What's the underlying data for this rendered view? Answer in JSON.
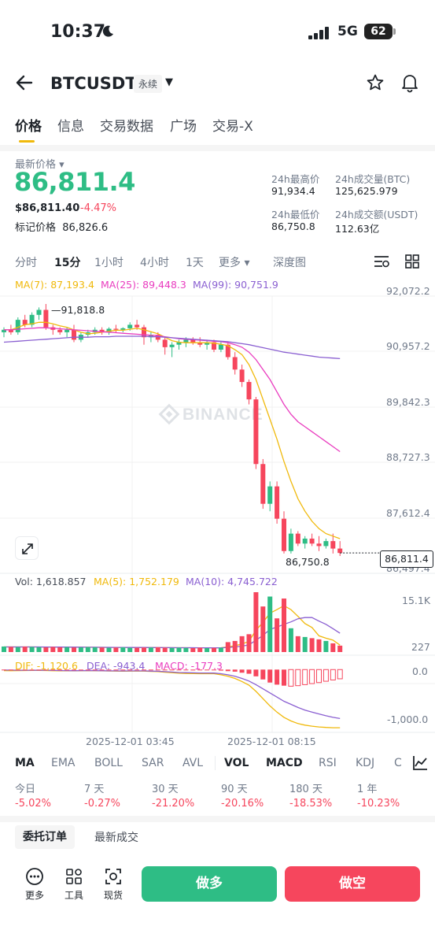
{
  "status": {
    "time": "10:37",
    "network": "5G",
    "battery": "62"
  },
  "header": {
    "symbol": "BTCUSDT",
    "contract_type": "永续"
  },
  "tabs": [
    {
      "label": "价格",
      "active": true
    },
    {
      "label": "信息"
    },
    {
      "label": "交易数据"
    },
    {
      "label": "广场"
    },
    {
      "label": "交易-X"
    }
  ],
  "price": {
    "label": "最新价格",
    "last": "86,811.4",
    "usd": "$86,811.40",
    "change": "-4.47%",
    "mark_label": "标记价格",
    "mark": "86,826.6"
  },
  "stats": {
    "high_label": "24h最高价",
    "high": "91,934.4",
    "vol_btc_label": "24h成交量(BTC)",
    "vol_btc": "125,625.979",
    "low_label": "24h最低价",
    "low": "86,750.8",
    "vol_usdt_label": "24h成交额(USDT)",
    "vol_usdt": "112.63亿"
  },
  "timeframes": [
    {
      "label": "分时"
    },
    {
      "label": "15分",
      "active": true
    },
    {
      "label": "1小时"
    },
    {
      "label": "4小时"
    },
    {
      "label": "1天"
    },
    {
      "label": "更多"
    },
    {
      "label": "深度图"
    }
  ],
  "legend": {
    "ma7": "MA(7): 87,193.4",
    "ma25": "MA(25): 89,448.3",
    "ma99": "MA(99): 90,751.9",
    "vol": "Vol: 1,618.857",
    "ma5": "MA(5): 1,752.179",
    "ma10": "MA(10): 4,745.722",
    "dif": "DIF: -1,120.6",
    "dea": "DEA: -943.4",
    "macd": "MACD: -177.3"
  },
  "colors": {
    "up": "#2ebd85",
    "down": "#f6465d",
    "ma7": "#f0b90b",
    "ma25": "#e93cbf",
    "ma99": "#8a5fd1",
    "accent": "#f0b90b"
  },
  "chart_labels": {
    "high_marker": "91,818.8",
    "low_marker": "86,750.8",
    "last_price": "86,811.4",
    "watermark": "BINANCE",
    "dates": [
      "2025-12-01 03:45",
      "2025-12-01 08:15"
    ]
  },
  "chart_data": [
    {
      "type": "candlestick",
      "title": "",
      "y_ticks": [
        "92,072.2",
        "90,957.2",
        "89,842.3",
        "88,727.3",
        "87,612.4",
        "86,497.4"
      ],
      "ylim": [
        86497.4,
        92072.2
      ],
      "candles": [
        [
          91250,
          91350,
          91150,
          91300
        ],
        [
          91300,
          91400,
          91200,
          91250
        ],
        [
          91250,
          91550,
          91200,
          91500
        ],
        [
          91500,
          91600,
          91350,
          91400
        ],
        [
          91400,
          91650,
          91350,
          91600
        ],
        [
          91600,
          91750,
          91500,
          91700
        ],
        [
          91700,
          91818.8,
          91300,
          91350
        ],
        [
          91350,
          91400,
          91200,
          91300
        ],
        [
          91300,
          91350,
          91200,
          91250
        ],
        [
          91250,
          91350,
          91150,
          91300
        ],
        [
          91300,
          91400,
          91050,
          91100
        ],
        [
          91100,
          91250,
          91050,
          91200
        ],
        [
          91200,
          91300,
          91150,
          91250
        ],
        [
          91250,
          91350,
          91200,
          91300
        ],
        [
          91300,
          91350,
          91200,
          91250
        ],
        [
          91250,
          91350,
          91200,
          91320
        ],
        [
          91320,
          91400,
          91250,
          91300
        ],
        [
          91300,
          91350,
          91250,
          91330
        ],
        [
          91330,
          91450,
          91280,
          91400
        ],
        [
          91400,
          91500,
          91300,
          91350
        ],
        [
          91350,
          91400,
          91000,
          91150
        ],
        [
          91150,
          91250,
          91050,
          91200
        ],
        [
          91200,
          91250,
          91050,
          91100
        ],
        [
          91100,
          91150,
          90800,
          90950
        ],
        [
          90950,
          91050,
          90750,
          91000
        ],
        [
          91000,
          91100,
          90900,
          91050
        ],
        [
          91050,
          91150,
          90950,
          91100
        ],
        [
          91100,
          91150,
          91000,
          91050
        ],
        [
          91050,
          91150,
          90950,
          91000
        ],
        [
          91000,
          91100,
          90900,
          91050
        ],
        [
          91050,
          91100,
          90850,
          90900
        ],
        [
          90900,
          91050,
          90850,
          91000
        ],
        [
          91000,
          91050,
          90700,
          90750
        ],
        [
          90750,
          90850,
          90400,
          90500
        ],
        [
          90500,
          90600,
          90150,
          90250
        ],
        [
          90250,
          90300,
          89800,
          89900
        ],
        [
          89900,
          89950,
          88500,
          88600
        ],
        [
          88600,
          88700,
          87700,
          87800
        ],
        [
          87800,
          88250,
          87650,
          88150
        ],
        [
          88150,
          88250,
          87400,
          87500
        ],
        [
          87500,
          87650,
          86800,
          86850
        ],
        [
          86850,
          87300,
          86800,
          87200
        ],
        [
          87200,
          87250,
          86950,
          87000
        ],
        [
          87000,
          87150,
          86900,
          87100
        ],
        [
          87100,
          87200,
          86950,
          87000
        ],
        [
          87000,
          87150,
          86850,
          86950
        ],
        [
          86950,
          87100,
          86900,
          87050
        ],
        [
          87050,
          87200,
          86800,
          86900
        ],
        [
          86900,
          87050,
          86750.8,
          86811.4
        ]
      ],
      "ma7": [
        91300,
        91300,
        91350,
        91400,
        91420,
        91450,
        91450,
        91420,
        91380,
        91350,
        91300,
        91250,
        91220,
        91230,
        91250,
        91270,
        91290,
        91290,
        91310,
        91330,
        91300,
        91260,
        91220,
        91150,
        91080,
        91050,
        91040,
        91040,
        91040,
        91040,
        91030,
        91010,
        90980,
        90900,
        90800,
        90600,
        90300,
        89900,
        89500,
        89100,
        88650,
        88250,
        87900,
        87650,
        87450,
        87300,
        87200,
        87150,
        87100
      ],
      "ma25": [
        91300,
        91300,
        91310,
        91320,
        91330,
        91340,
        91340,
        91330,
        91320,
        91310,
        91300,
        91290,
        91280,
        91270,
        91260,
        91250,
        91240,
        91230,
        91220,
        91210,
        91200,
        91190,
        91180,
        91160,
        91140,
        91120,
        91110,
        91100,
        91090,
        91080,
        91070,
        91060,
        91040,
        91000,
        90950,
        90850,
        90700,
        90500,
        90300,
        90050,
        89800,
        89600,
        89450,
        89350,
        89250,
        89150,
        89050,
        88950,
        88850
      ],
      "ma99": [
        91050,
        91060,
        91070,
        91080,
        91090,
        91100,
        91110,
        91120,
        91130,
        91140,
        91150,
        91150,
        91150,
        91160,
        91160,
        91160,
        91170,
        91170,
        91170,
        91170,
        91170,
        91160,
        91160,
        91150,
        91140,
        91130,
        91120,
        91110,
        91100,
        91090,
        91080,
        91070,
        91060,
        91040,
        91020,
        91000,
        90970,
        90940,
        90910,
        90880,
        90850,
        90830,
        90810,
        90790,
        90770,
        90750,
        90740,
        90730,
        90720
      ]
    },
    {
      "type": "bar",
      "title": "",
      "y_ticks": [
        "15.1K",
        "227"
      ],
      "ylim": [
        227,
        15100
      ],
      "values": [
        1400,
        1300,
        1250,
        1350,
        1300,
        1250,
        1200,
        1300,
        1200,
        1250,
        1150,
        1200,
        1250,
        1200,
        1150,
        1100,
        1150,
        1200,
        1100,
        1100,
        1150,
        1150,
        1200,
        1100,
        1050,
        1100,
        1050,
        1000,
        1100,
        1000,
        1050,
        1100,
        2500,
        2800,
        4000,
        4500,
        15100,
        11500,
        14000,
        8500,
        13500,
        6000,
        4000,
        3800,
        3500,
        3200,
        2800,
        2200,
        1618.857
      ],
      "ma5": [
        1300,
        1300,
        1300,
        1300,
        1300,
        1280,
        1270,
        1260,
        1250,
        1240,
        1230,
        1220,
        1210,
        1200,
        1190,
        1180,
        1170,
        1160,
        1150,
        1150,
        1140,
        1130,
        1120,
        1110,
        1100,
        1100,
        1090,
        1080,
        1070,
        1060,
        1050,
        1100,
        1300,
        1600,
        2000,
        2700,
        5500,
        7500,
        9800,
        10700,
        11700,
        10700,
        9000,
        7200,
        6200,
        4100,
        3500,
        3000,
        1752.179
      ],
      "ma10": [
        1300,
        1300,
        1300,
        1300,
        1300,
        1290,
        1280,
        1270,
        1260,
        1250,
        1240,
        1230,
        1220,
        1210,
        1200,
        1190,
        1180,
        1170,
        1160,
        1150,
        1150,
        1140,
        1130,
        1120,
        1110,
        1100,
        1090,
        1090,
        1080,
        1070,
        1060,
        1080,
        1150,
        1300,
        1500,
        1800,
        3000,
        4200,
        5700,
        6300,
        7000,
        7600,
        8400,
        8700,
        8700,
        7800,
        7000,
        5900,
        4745.722
      ]
    },
    {
      "type": "bar",
      "title": "",
      "y_ticks": [
        "0.0",
        "-1,000.0"
      ],
      "ylim": [
        -1210,
        80
      ],
      "macd": [
        -10,
        -12,
        -8,
        -5,
        -3,
        -4,
        -6,
        -8,
        -7,
        -5,
        -3,
        -2,
        -1,
        -2,
        -3,
        -4,
        -5,
        -6,
        -5,
        -4,
        -5,
        -6,
        -8,
        -10,
        -12,
        -14,
        -15,
        -16,
        -15,
        -14,
        -13,
        -20,
        -30,
        -40,
        -60,
        -80,
        -130,
        -190,
        -250,
        -290,
        -310,
        -320,
        -310,
        -290,
        -270,
        -250,
        -225,
        -200,
        -177.3
      ],
      "dif": [
        -20,
        -22,
        -20,
        -18,
        -15,
        -15,
        -18,
        -22,
        -25,
        -25,
        -24,
        -22,
        -20,
        -22,
        -25,
        -28,
        -30,
        -32,
        -30,
        -28,
        -30,
        -35,
        -40,
        -50,
        -60,
        -70,
        -75,
        -78,
        -80,
        -80,
        -80,
        -100,
        -130,
        -170,
        -230,
        -300,
        -420,
        -560,
        -700,
        -820,
        -920,
        -990,
        -1040,
        -1070,
        -1090,
        -1105,
        -1115,
        -1120,
        -1120.6
      ],
      "dea": [
        -10,
        -10,
        -12,
        -13,
        -12,
        -11,
        -12,
        -14,
        -18,
        -20,
        -21,
        -20,
        -19,
        -20,
        -22,
        -24,
        -25,
        -26,
        -25,
        -24,
        -25,
        -29,
        -32,
        -40,
        -48,
        -56,
        -60,
        -62,
        -65,
        -66,
        -67,
        -80,
        -100,
        -130,
        -170,
        -220,
        -290,
        -370,
        -450,
        -530,
        -610,
        -670,
        -730,
        -780,
        -820,
        -855,
        -890,
        -920,
        -943.4
      ]
    }
  ],
  "indicators": [
    {
      "label": "MA",
      "active": true
    },
    {
      "label": "EMA"
    },
    {
      "label": "BOLL"
    },
    {
      "label": "SAR"
    },
    {
      "label": "AVL"
    },
    {
      "label": "VOL",
      "active": true
    },
    {
      "label": "MACD",
      "active": true
    },
    {
      "label": "RSI"
    },
    {
      "label": "KDJ"
    },
    {
      "label": "C"
    }
  ],
  "performance": [
    {
      "label": "今日",
      "value": "-5.02%"
    },
    {
      "label": "7 天",
      "value": "-0.27%"
    },
    {
      "label": "30 天",
      "value": "-21.20%"
    },
    {
      "label": "90 天",
      "value": "-20.16%"
    },
    {
      "label": "180 天",
      "value": "-18.53%"
    },
    {
      "label": "1 年",
      "value": "-10.23%"
    }
  ],
  "book_tabs": {
    "orders": "委托订单",
    "trades": "最新成交"
  },
  "bottom": {
    "more": "更多",
    "tools": "工具",
    "spot": "现货",
    "long": "做多",
    "short": "做空"
  }
}
